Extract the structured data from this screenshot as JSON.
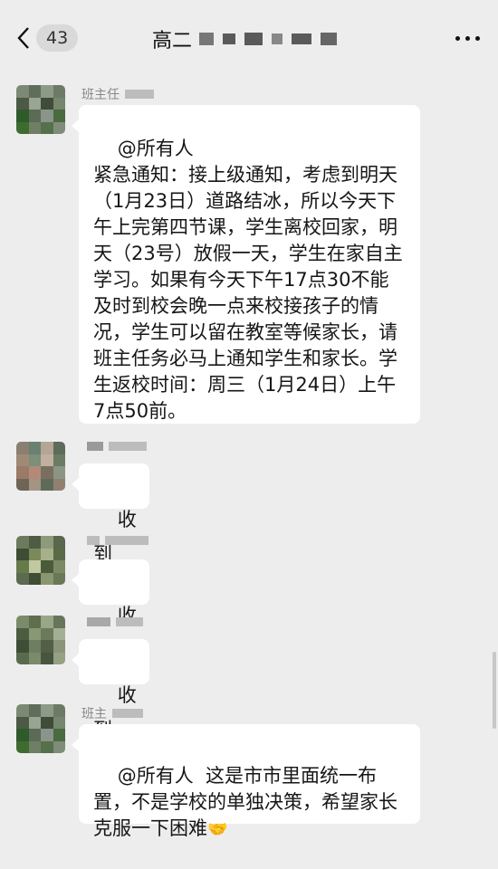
{
  "header": {
    "unread_count": "43",
    "title_prefix": "高二"
  },
  "messages": [
    {
      "sender": "班主任",
      "text": "@所有人\n紧急通知：接上级通知，考虑到明天（1月23日）道路结冰，所以今天下午上完第四节课，学生离校回家，明天（23号）放假一天，学生在家自主学习。如果有今天下午17点30不能及时到校会晚一点来校接孩子的情况，学生可以留在教室等候家长，请班主任务必马上通知学生和家长。学生返校时间：周三（1月24日）上午7点50前。"
    },
    {
      "sender": "",
      "text": "收到"
    },
    {
      "sender": "",
      "text": "收到"
    },
    {
      "sender": "",
      "text": "收到"
    },
    {
      "sender": "班主",
      "text": "@所有人  这是市市里面统一布置，不是学校的单独决策，希望家长克服一下困难",
      "emoji": "handshake-emoji"
    }
  ],
  "colors": {
    "background": "#ededed",
    "bubble": "#ffffff",
    "sender_name": "#888888"
  }
}
